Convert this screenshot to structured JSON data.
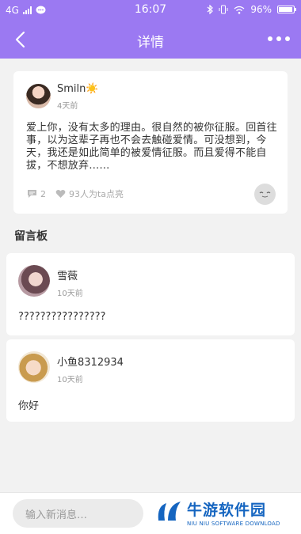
{
  "status_bar": {
    "network": "4G",
    "time": "16:07",
    "battery": "96%"
  },
  "nav": {
    "title": "详情"
  },
  "post": {
    "author": "Smiln☀️",
    "time": "4天前",
    "body": "爱上你，没有太多的理由。很自然的被你征服。回首往事，以为这辈子再也不会去触碰爱情。可没想到，今天，我还是如此简单的被爱情征服。而且爱得不能自拔，不想放弃……",
    "comment_count": "2",
    "likes_text": "93人为ta点亮"
  },
  "board": {
    "title": "留言板",
    "messages": [
      {
        "name": "雪薇",
        "time": "10天前",
        "content": "????????????????"
      },
      {
        "name": "小鱼8312934",
        "time": "10天前",
        "content": "你好"
      }
    ]
  },
  "input": {
    "placeholder": "输入新消息…"
  },
  "watermark": {
    "brand": "牛游软件园",
    "sub": "NIU NIU SOFTWARE DOWNLOAD"
  },
  "colors": {
    "accent": "#9b79f2",
    "brand_watermark": "#1565c0"
  },
  "icons": [
    "signal-icon",
    "chat-bubble-icon",
    "bluetooth-icon",
    "vibrate-icon",
    "wifi-icon",
    "battery-icon",
    "back-arrow-icon",
    "more-icon",
    "comment-icon",
    "heart-icon",
    "reply-emoji-icon"
  ]
}
